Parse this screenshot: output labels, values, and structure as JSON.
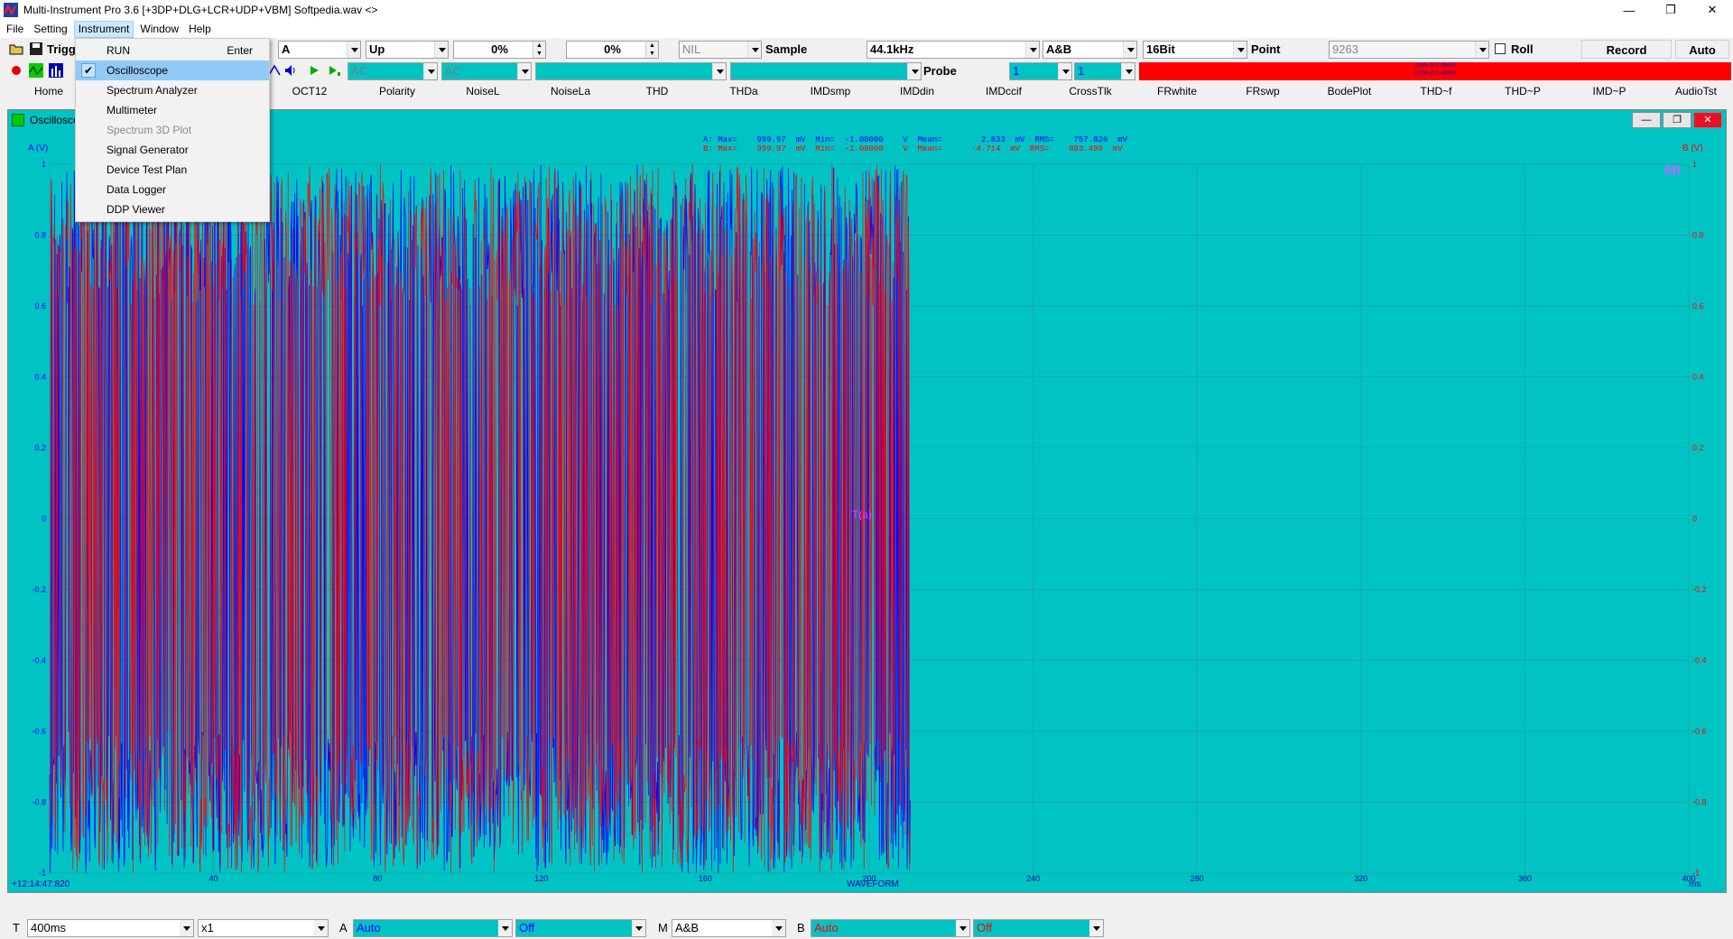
{
  "window": {
    "title": "Multi-Instrument Pro 3.6   [+3DP+DLG+LCR+UDP+VBM]   Softpedia.wav   <>",
    "minimize": "—",
    "restore": "❐",
    "close": "✕"
  },
  "menubar": {
    "items": [
      "File",
      "Setting",
      "Instrument",
      "Window",
      "Help"
    ]
  },
  "instrument_menu": {
    "items": [
      {
        "label": "RUN",
        "shortcut": "Enter",
        "checked": false,
        "disabled": false
      },
      {
        "label": "Oscilloscope",
        "shortcut": "",
        "checked": true,
        "disabled": false
      },
      {
        "label": "Spectrum Analyzer",
        "shortcut": "",
        "checked": false,
        "disabled": false
      },
      {
        "label": "Multimeter",
        "shortcut": "",
        "checked": false,
        "disabled": false
      },
      {
        "label": "Spectrum 3D Plot",
        "shortcut": "",
        "checked": false,
        "disabled": true
      },
      {
        "label": "Signal Generator",
        "shortcut": "",
        "checked": false,
        "disabled": false
      },
      {
        "label": "Device Test Plan",
        "shortcut": "",
        "checked": false,
        "disabled": false
      },
      {
        "label": "Data Logger",
        "shortcut": "",
        "checked": false,
        "disabled": false
      },
      {
        "label": "DDP Viewer",
        "shortcut": "",
        "checked": false,
        "disabled": false
      }
    ],
    "check_mark": "✔"
  },
  "toolbar1": {
    "trigger_label": "Trigg",
    "trigger_source": "A",
    "trigger_edge": "Up",
    "trigger_level": "0%",
    "trigger_delay": "0%",
    "nil": "NIL",
    "sample_label": "Sample",
    "sample_rate": "44.1kHz",
    "channels": "A&B",
    "bits": "16Bit",
    "point_label": "Point",
    "points": "9263",
    "roll_label": "Roll",
    "record_label": "Record",
    "auto_label": "Auto"
  },
  "toolbar2": {
    "coupling_a": "AC",
    "coupling_b": "AC",
    "probe_label": "Probe",
    "probe_a": "1",
    "probe_b": "1",
    "level_meter_a": "100% (0.0 dBFS)",
    "level_meter_b": "100% (0.0 dBFS)"
  },
  "tabs": [
    "Home",
    "OCT12",
    "Polarity",
    "NoiseL",
    "NoiseLa",
    "THD",
    "THDa",
    "IMDsmp",
    "IMDdin",
    "IMDccif",
    "CrossTlk",
    "FRwhite",
    "FRswp",
    "BodePlot",
    "THD~f",
    "THD~P",
    "IMD~P",
    "AudioTst"
  ],
  "oscilloscope": {
    "title": "Oscilloscope",
    "stats_a": "A: Max=    999.97  mV  Min=  -1.00000    V  Mean=        2.833  mV  RMS=    757.826  mV",
    "stats_b": "B: Max=    999.97  mV  Min=  -1.00000    V  Mean=      -4.714  mV  RMS=    803.499  mV",
    "y_label_left": "A (V)",
    "y_label_right": "B (V)",
    "x_label": "WAVEFORM",
    "x_unit": "ms",
    "timestamp": "+12:14:47:820",
    "watermark": "MI",
    "trigger_marker": "T(a)",
    "colors": {
      "background": "#00c4c4",
      "channel_a": "#0000ff",
      "channel_b": "#ff0000",
      "grid": "#1aa8a8"
    }
  },
  "chart_data": {
    "type": "line",
    "title": "",
    "xlabel": "WAVEFORM",
    "ylabel": "A (V)",
    "ylabel_right": "B (V)",
    "xlim": [
      0,
      400
    ],
    "ylim": [
      -1,
      1
    ],
    "x_ticks": [
      "40",
      "80",
      "120",
      "160",
      "200",
      "240",
      "280",
      "320",
      "360",
      "400"
    ],
    "y_ticks_left": [
      "1",
      "0.8",
      "0.6",
      "0.4",
      "0.2",
      "0",
      "-0.2",
      "-0.4",
      "-0.6",
      "-0.8",
      "-1"
    ],
    "y_ticks_right": [
      "1",
      "0.8",
      "0.6",
      "0.4",
      "0.2",
      "0",
      "-0.2",
      "-0.4",
      "-0.6",
      "-0.8",
      "-1"
    ],
    "grid": true,
    "signal_end_ms": 210,
    "series": [
      {
        "name": "A",
        "color": "#0000ff",
        "max_mV": 999.97,
        "min_V": -1.0,
        "mean_mV": 2.833,
        "rms_mV": 757.826
      },
      {
        "name": "B",
        "color": "#ff0000",
        "max_mV": 999.97,
        "min_V": -1.0,
        "mean_mV": -4.714,
        "rms_mV": 803.499
      }
    ]
  },
  "bottombar": {
    "t_label": "T",
    "timebase": "400ms",
    "zoom": "x1",
    "a_label": "A",
    "a_range": "Auto",
    "a_offset": "Off",
    "m_label": "M",
    "m_value": "A&B",
    "b_label": "B",
    "b_range": "Auto",
    "b_offset": "Off"
  }
}
